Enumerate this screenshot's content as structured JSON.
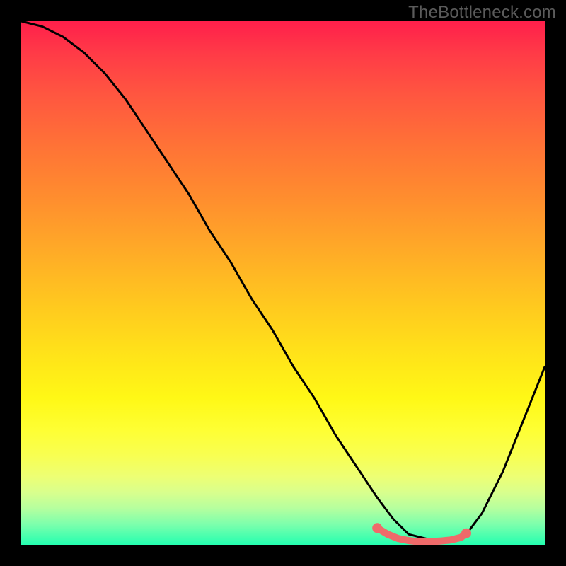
{
  "watermark": "TheBottleneck.com",
  "chart_data": {
    "type": "line",
    "title": "",
    "xlabel": "",
    "ylabel": "",
    "xlim": [
      0,
      100
    ],
    "ylim": [
      0,
      100
    ],
    "gradient_stops": [
      {
        "pos": 0,
        "color": "#ff1f4b"
      },
      {
        "pos": 14,
        "color": "#ff5640"
      },
      {
        "pos": 34,
        "color": "#ff8e2e"
      },
      {
        "pos": 54,
        "color": "#ffc81f"
      },
      {
        "pos": 72,
        "color": "#fff816"
      },
      {
        "pos": 87,
        "color": "#edff74"
      },
      {
        "pos": 100,
        "color": "#24ffb0"
      }
    ],
    "series": [
      {
        "name": "bottleneck-curve",
        "color": "#000000",
        "x": [
          0,
          4,
          8,
          12,
          16,
          20,
          24,
          28,
          32,
          36,
          40,
          44,
          48,
          52,
          56,
          60,
          64,
          68,
          71,
          74,
          78,
          82,
          85,
          88,
          92,
          96,
          100
        ],
        "y": [
          100,
          99,
          97,
          94,
          90,
          85,
          79,
          73,
          67,
          60,
          54,
          47,
          41,
          34,
          28,
          21,
          15,
          9,
          5,
          2,
          1,
          1,
          2,
          6,
          14,
          24,
          34
        ]
      },
      {
        "name": "optimal-range-marker",
        "color": "#ef6a6a",
        "x": [
          68,
          70,
          72,
          74,
          76,
          78,
          80,
          82,
          84,
          85
        ],
        "y": [
          3.2,
          2.0,
          1.2,
          0.8,
          0.6,
          0.6,
          0.7,
          0.9,
          1.4,
          2.2
        ]
      }
    ],
    "annotations": []
  }
}
